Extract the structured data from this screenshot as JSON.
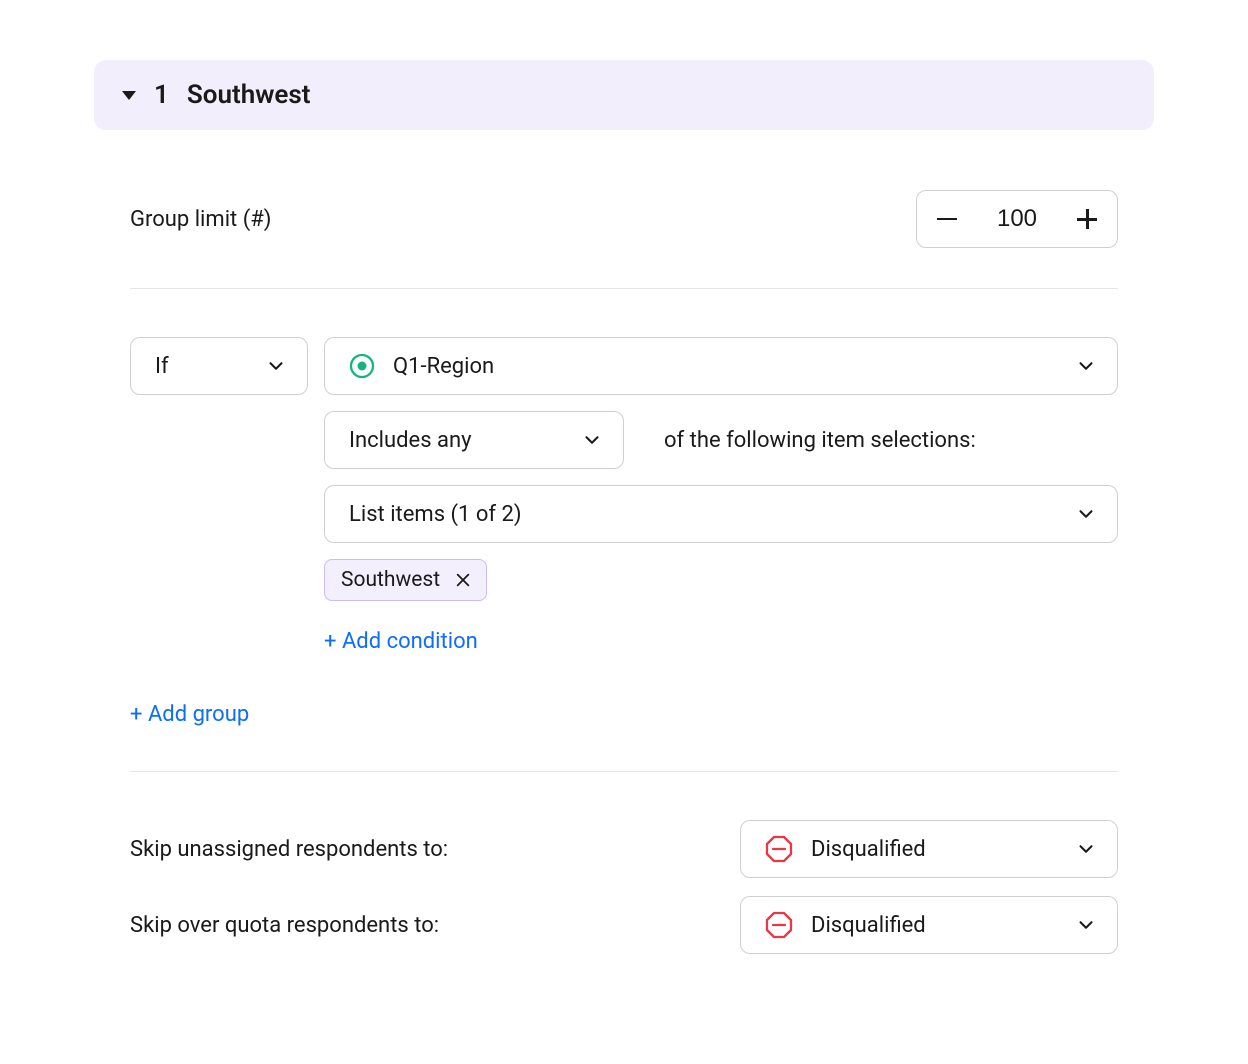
{
  "group": {
    "number": "1",
    "title": "Southwest"
  },
  "limit": {
    "label": "Group limit (#)",
    "value": "100"
  },
  "condition": {
    "if_label": "If",
    "question": "Q1-Region",
    "operator": "Includes any",
    "following_text": "of the following item selections:",
    "list_items_label": "List items (1 of 2)",
    "chip": "Southwest",
    "add_condition": "+ Add condition"
  },
  "add_group": "+ Add group",
  "skip": {
    "unassigned_label": "Skip unassigned respondents to:",
    "unassigned_value": "Disqualified",
    "overquota_label": "Skip over quota respondents to:",
    "overquota_value": "Disqualified"
  }
}
